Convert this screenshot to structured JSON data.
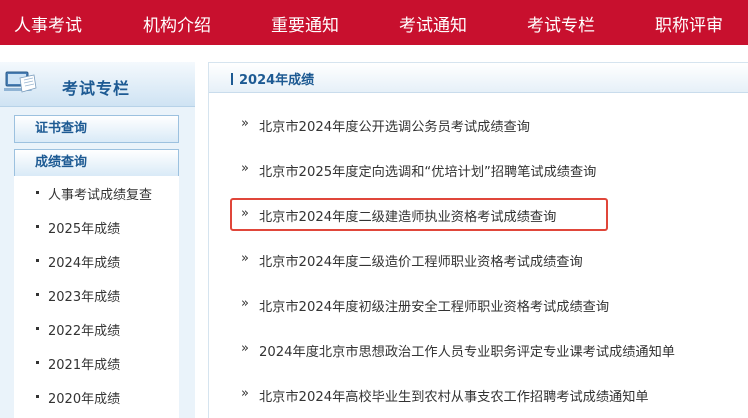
{
  "nav": {
    "items": [
      "人事考试",
      "机构介绍",
      "重要通知",
      "考试通知",
      "考试专栏",
      "职称评审"
    ]
  },
  "sidebar": {
    "title": "考试专栏",
    "sections": [
      "证书查询",
      "成绩查询"
    ],
    "items": [
      "人事考试成绩复查",
      "2025年成绩",
      "2024年成绩",
      "2023年成绩",
      "2022年成绩",
      "2021年成绩",
      "2020年成绩"
    ]
  },
  "main": {
    "title": "2024年成绩",
    "rows": [
      "北京市2024年度公开选调公务员考试成绩查询",
      "北京市2025年度定向选调和“优培计划”招聘笔试成绩查询",
      "北京市2024年度二级建造师执业资格考试成绩查询",
      "北京市2024年度二级造价工程师职业资格考试成绩查询",
      "北京市2024年度初级注册安全工程师职业资格考试成绩查询",
      "2024年度北京市思想政治工作人员专业职务评定专业课考试成绩通知单",
      "北京市2024年高校毕业生到农村从事支农工作招聘考试成绩通知单"
    ],
    "chevron": "»"
  },
  "colors": {
    "nav_bg": "#c8102e",
    "accent": "#1d5a93",
    "highlight_border": "#e0463a"
  }
}
